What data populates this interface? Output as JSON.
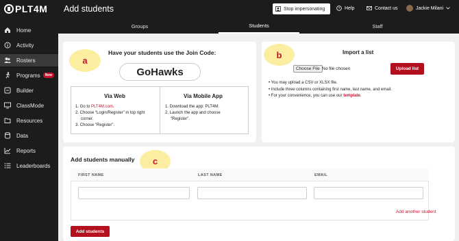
{
  "brand": {
    "logo_text": "PLT4M"
  },
  "header": {
    "title": "Add students",
    "stop_impersonating": "Stop impersonating",
    "help": "Help",
    "contact": "Contact us",
    "user_name": "Jackie Milani"
  },
  "sidebar": {
    "items": [
      {
        "label": "Home",
        "icon": "home-icon"
      },
      {
        "label": "Activity",
        "icon": "info-icon"
      },
      {
        "label": "Rosters",
        "icon": "people-icon",
        "active": true
      },
      {
        "label": "Programs",
        "icon": "runner-icon",
        "badge": "New"
      },
      {
        "label": "Builder",
        "icon": "builder-icon"
      },
      {
        "label": "ClassMode",
        "icon": "classmode-icon"
      },
      {
        "label": "Resources",
        "icon": "resources-icon"
      },
      {
        "label": "Data",
        "icon": "database-icon"
      },
      {
        "label": "Reports",
        "icon": "chart-icon"
      },
      {
        "label": "Leaderboards",
        "icon": "list-icon"
      }
    ]
  },
  "tabs": {
    "groups": "Groups",
    "students": "Students",
    "staff": "Staff"
  },
  "annotations": {
    "a": "a",
    "b": "b",
    "c": "c"
  },
  "join": {
    "heading": "Have your students use the Join Code:",
    "code": "GoHawks",
    "web": {
      "title": "Via Web",
      "step1_prefix": "1. Go to ",
      "step1_link": "PLT4M.com",
      "step1_suffix": ".",
      "step2": "2. Choose “Login/Register” in top right",
      "step2b": "corner.",
      "step3": "3. Choose “Register”."
    },
    "mobile": {
      "title": "Via Mobile App",
      "step1": "1. Download the app: PLT4M.",
      "step2": "2. Launch the app and choose",
      "step2b": "“Register”."
    }
  },
  "import": {
    "heading": "Import a list",
    "choose_file": "Choose File",
    "no_file": "No file chosen",
    "upload": "Upload list",
    "bullet1": "You may upload a CSV or XLSX file.",
    "bullet2": "Include three columns containing first name, last name, and email.",
    "bullet3_prefix": "For your convenience, you can use our ",
    "bullet3_link": "template",
    "bullet3_suffix": "."
  },
  "manual": {
    "heading": "Add students manually",
    "columns": {
      "first": "FIRST NAME",
      "last": "LAST NAME",
      "email": "EMAIL"
    },
    "add_another": "Add another student",
    "submit": "Add students"
  }
}
